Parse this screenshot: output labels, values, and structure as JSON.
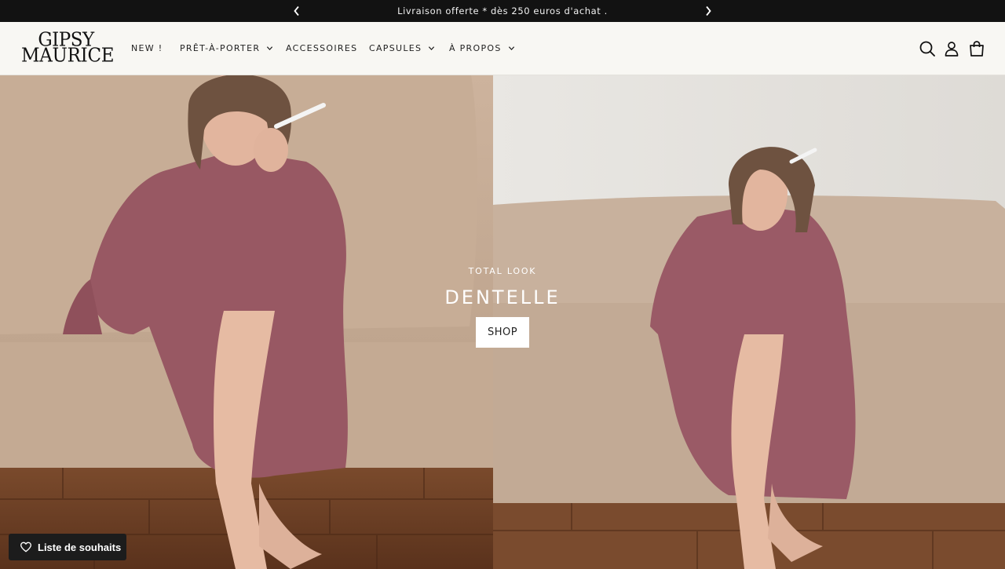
{
  "announcement": {
    "text": "Livraison offerte * dès 250 euros d'achat .",
    "prev_icon": "chevron-left-icon",
    "next_icon": "chevron-right-icon"
  },
  "header": {
    "logo": {
      "line1": "GIPSY",
      "line2": "MAURICE"
    },
    "nav": [
      {
        "label": "NEW !",
        "has_dropdown": false
      },
      {
        "label": "PRÊT-À-PORTER",
        "has_dropdown": true
      },
      {
        "label": "ACCESSOIRES",
        "has_dropdown": false
      },
      {
        "label": "CAPSULES",
        "has_dropdown": true
      },
      {
        "label": "À PROPOS",
        "has_dropdown": true
      }
    ],
    "icons": [
      "search-icon",
      "account-icon",
      "cart-icon"
    ]
  },
  "hero": {
    "subtitle": "TOTAL LOOK",
    "title": "DENTELLE",
    "button": "SHOP",
    "images": [
      "woman-on-sofa-photo-left",
      "woman-on-sofa-photo-right"
    ]
  },
  "wishlist": {
    "label": "Liste de souhaits",
    "icon": "heart-icon"
  },
  "colors": {
    "announcement_bg": "#121212",
    "header_bg": "#f8f7f3",
    "dress": "#9a5a66",
    "sofa": "#c9b29c"
  }
}
